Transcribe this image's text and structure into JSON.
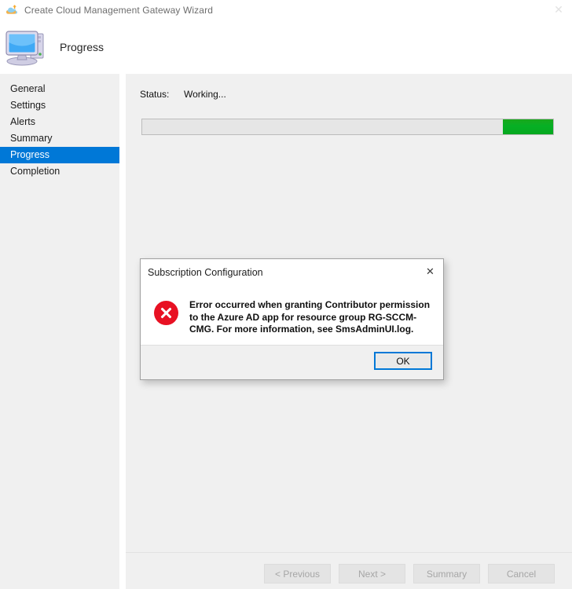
{
  "window": {
    "title": "Create Cloud Management Gateway Wizard",
    "icon": "cloud-upload-icon",
    "close_label": "✕"
  },
  "header": {
    "icon": "computer-icon",
    "title": "Progress"
  },
  "sidebar": {
    "items": [
      {
        "label": "General",
        "selected": false
      },
      {
        "label": "Settings",
        "selected": false
      },
      {
        "label": "Alerts",
        "selected": false
      },
      {
        "label": "Summary",
        "selected": false
      },
      {
        "label": "Progress",
        "selected": true
      },
      {
        "label": "Completion",
        "selected": false
      }
    ],
    "selected_color": "#0078d7",
    "background": "#f0f0f0"
  },
  "main": {
    "status_label": "Status:",
    "status_value": "Working...",
    "progress": {
      "style": "marquee",
      "chunk_color": "#06b025",
      "track_color": "#e6e6e6",
      "position_percent": 100
    }
  },
  "footer": {
    "buttons": [
      {
        "label": "< Previous",
        "enabled": false
      },
      {
        "label": "Next >",
        "enabled": false
      },
      {
        "label": "Summary",
        "enabled": false
      },
      {
        "label": "Cancel",
        "enabled": false
      }
    ]
  },
  "dialog": {
    "title": "Subscription Configuration",
    "close_label": "✕",
    "icon": "error-icon",
    "icon_color": "#e81123",
    "message": "Error occurred when granting Contributor permission to the Azure AD app for resource group RG-SCCM-CMG. For more information, see SmsAdminUI.log.",
    "ok_label": "OK",
    "focus_color": "#0078d7"
  }
}
